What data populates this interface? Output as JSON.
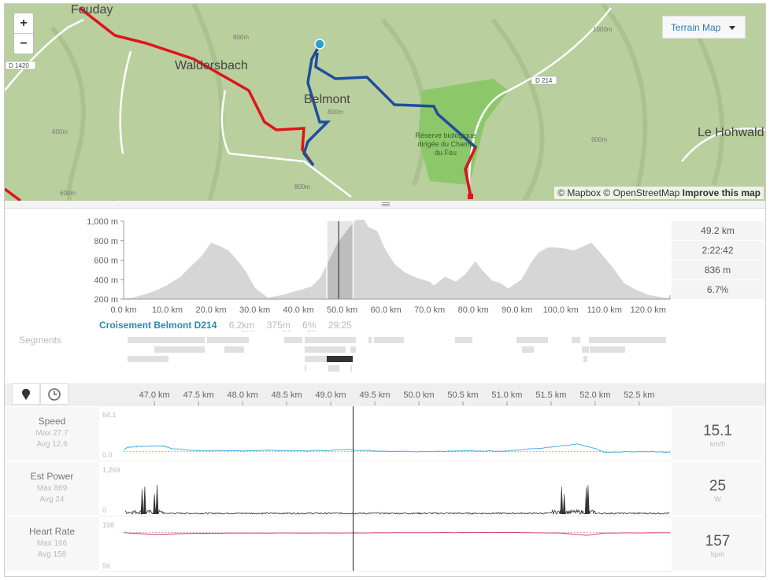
{
  "map": {
    "zoom_in": "+",
    "zoom_out": "−",
    "layer_select": "Terrain Map",
    "attribution": "© Mapbox © OpenStreetMap",
    "improve_link": "Improve this map",
    "places": [
      "Fouday",
      "Waldersbach",
      "Belmont",
      "Le Hohwald",
      "Réserve biologique",
      "dirigée du Champ",
      "du Feu"
    ],
    "road_labels": [
      "D 1420",
      "D 214"
    ],
    "contour_labels": [
      "800m",
      "600m",
      "800m",
      "600m",
      "800m",
      "1000m",
      "900m"
    ],
    "colors": {
      "route": "#e0141a",
      "segment": "#1f4e9c",
      "marker": "#2aa0d0",
      "terrain": "#b9cf9e",
      "reserve": "#8cc86a"
    }
  },
  "elevation": {
    "stats": [
      "49.2 km",
      "2:22:42",
      "836 m",
      "6.7%"
    ],
    "y_ticks": [
      "1,000 m",
      "800 m",
      "600 m",
      "400 m",
      "200 m"
    ],
    "x_ticks": [
      "0.0 km",
      "10.0 km",
      "20.0 km",
      "30.0 km",
      "40.0 km",
      "50.0 km",
      "60.0 km",
      "70.0 km",
      "80.0 km",
      "90.0 km",
      "100.0 km",
      "110.0 km",
      "120.0 km"
    ]
  },
  "chart_data": {
    "type": "area",
    "xlabel": "",
    "ylabel": "",
    "xlim": [
      0,
      125
    ],
    "ylim": [
      200,
      1000
    ],
    "x": [
      0,
      2,
      5,
      8,
      10,
      13,
      15,
      18,
      20,
      22,
      24,
      26,
      28,
      30,
      33,
      36,
      40,
      43,
      45,
      47,
      49,
      51,
      53,
      54,
      55,
      56,
      58,
      60,
      62,
      64.4,
      67,
      70,
      71,
      73.5,
      76,
      78,
      80.5,
      82,
      84.3,
      86,
      88,
      91,
      93.4,
      95,
      97,
      98.8,
      101,
      103,
      105,
      107,
      109,
      112,
      114.5,
      117,
      120,
      123,
      125
    ],
    "y": [
      210,
      215,
      250,
      300,
      345,
      430,
      520,
      650,
      780,
      745,
      700,
      600,
      480,
      320,
      215,
      240,
      290,
      330,
      420,
      600,
      780,
      900,
      1010,
      1060,
      1020,
      940,
      900,
      700,
      560,
      473,
      420,
      380,
      340,
      430,
      380,
      450,
      590,
      500,
      390,
      370,
      310,
      400,
      590,
      680,
      730,
      730,
      720,
      700,
      740,
      780,
      680,
      520,
      365,
      300,
      245,
      220,
      210
    ],
    "selection_km": [
      46.5,
      52.5
    ],
    "cursor_km": 49.2
  },
  "segment": {
    "name": "Croisement Belmont D214",
    "distance": "6.2",
    "distance_unit": "km",
    "elev": "375",
    "elev_unit": "m",
    "grade": "6",
    "grade_unit": "%",
    "time": "29:25",
    "section_label": "Segments"
  },
  "toolbar": {
    "distance_icon": "map-pin-icon",
    "time_icon": "clock-icon",
    "ticks": [
      "47.0 km",
      "47.5 km",
      "48.0 km",
      "48.5 km",
      "49.0 km",
      "49.5 km",
      "50.0 km",
      "50.5 km",
      "51.0 km",
      "51.5 km",
      "52.0 km",
      "52.5 km"
    ],
    "range_km": [
      46.65,
      52.85
    ],
    "cursor_km": 49.25
  },
  "streams": [
    {
      "label": "Speed",
      "max": "Max 27.7",
      "avg": "Avg 12.6",
      "top": "64.1",
      "bottom": "0.0",
      "value": "15.1",
      "unit": "km/h",
      "color": "#4ab0de",
      "scale": [
        0,
        64.1
      ],
      "points": [
        [
          46.65,
          10
        ],
        [
          46.7,
          14
        ],
        [
          46.8,
          15
        ],
        [
          47.0,
          16
        ],
        [
          47.1,
          16
        ],
        [
          47.2,
          12
        ],
        [
          47.4,
          9
        ],
        [
          47.8,
          8
        ],
        [
          48.3,
          9
        ],
        [
          48.7,
          8
        ],
        [
          49.2,
          10
        ],
        [
          49.5,
          8
        ],
        [
          50,
          7
        ],
        [
          50.5,
          8
        ],
        [
          51,
          8
        ],
        [
          51.5,
          14
        ],
        [
          51.8,
          19
        ],
        [
          52.0,
          12
        ],
        [
          52.1,
          6
        ],
        [
          52.5,
          7
        ],
        [
          52.85,
          6
        ]
      ]
    },
    {
      "label": "Est Power",
      "max": "Max 869",
      "avg": "Avg 24",
      "top": "1,269",
      "bottom": "0",
      "value": "25",
      "unit": "W",
      "color": "#333333",
      "scale": [
        0,
        1269
      ],
      "spikes": [
        [
          46.86,
          740
        ],
        [
          46.89,
          820
        ],
        [
          47.0,
          600
        ],
        [
          47.03,
          869
        ],
        [
          51.62,
          820
        ],
        [
          51.65,
          600
        ],
        [
          51.9,
          800
        ],
        [
          51.92,
          869
        ]
      ]
    },
    {
      "label": "Heart Rate",
      "max": "Max 166",
      "avg": "Avg 158",
      "top": "198",
      "bottom": "56",
      "value": "157",
      "unit": "bpm",
      "color": "#d0407a",
      "scale": [
        56,
        198
      ],
      "points": [
        [
          46.65,
          176
        ],
        [
          47.0,
          170
        ],
        [
          47.3,
          173
        ],
        [
          48.0,
          175
        ],
        [
          49,
          175
        ],
        [
          50,
          176
        ],
        [
          51,
          177
        ],
        [
          51.6,
          175
        ],
        [
          51.9,
          167
        ],
        [
          52.1,
          175
        ],
        [
          52.85,
          176
        ]
      ]
    }
  ]
}
